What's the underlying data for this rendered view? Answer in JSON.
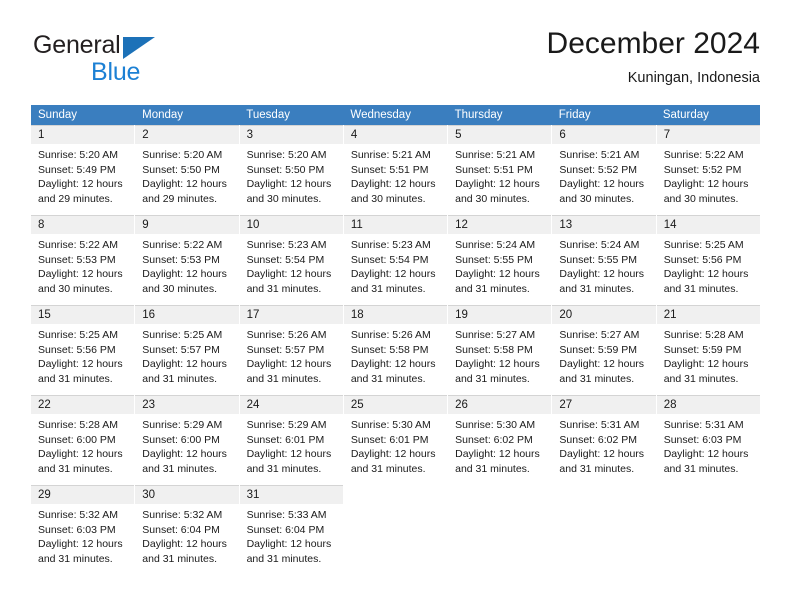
{
  "branding": {
    "logo_primary": "General",
    "logo_secondary": "Blue",
    "logo_icon": "blue-triangle"
  },
  "header": {
    "title": "December 2024",
    "subtitle": "Kuningan, Indonesia"
  },
  "colors": {
    "header_blue": "#3a7ebf",
    "daynum_band": "#f0f0f0",
    "logo_blue": "#1c80d4",
    "text": "#1a1a1a"
  },
  "weekdays": [
    "Sunday",
    "Monday",
    "Tuesday",
    "Wednesday",
    "Thursday",
    "Friday",
    "Saturday"
  ],
  "weeks": [
    [
      {
        "day": "1",
        "sunrise": "Sunrise: 5:20 AM",
        "sunset": "Sunset: 5:49 PM",
        "daylight1": "Daylight: 12 hours",
        "daylight2": "and 29 minutes."
      },
      {
        "day": "2",
        "sunrise": "Sunrise: 5:20 AM",
        "sunset": "Sunset: 5:50 PM",
        "daylight1": "Daylight: 12 hours",
        "daylight2": "and 29 minutes."
      },
      {
        "day": "3",
        "sunrise": "Sunrise: 5:20 AM",
        "sunset": "Sunset: 5:50 PM",
        "daylight1": "Daylight: 12 hours",
        "daylight2": "and 30 minutes."
      },
      {
        "day": "4",
        "sunrise": "Sunrise: 5:21 AM",
        "sunset": "Sunset: 5:51 PM",
        "daylight1": "Daylight: 12 hours",
        "daylight2": "and 30 minutes."
      },
      {
        "day": "5",
        "sunrise": "Sunrise: 5:21 AM",
        "sunset": "Sunset: 5:51 PM",
        "daylight1": "Daylight: 12 hours",
        "daylight2": "and 30 minutes."
      },
      {
        "day": "6",
        "sunrise": "Sunrise: 5:21 AM",
        "sunset": "Sunset: 5:52 PM",
        "daylight1": "Daylight: 12 hours",
        "daylight2": "and 30 minutes."
      },
      {
        "day": "7",
        "sunrise": "Sunrise: 5:22 AM",
        "sunset": "Sunset: 5:52 PM",
        "daylight1": "Daylight: 12 hours",
        "daylight2": "and 30 minutes."
      }
    ],
    [
      {
        "day": "8",
        "sunrise": "Sunrise: 5:22 AM",
        "sunset": "Sunset: 5:53 PM",
        "daylight1": "Daylight: 12 hours",
        "daylight2": "and 30 minutes."
      },
      {
        "day": "9",
        "sunrise": "Sunrise: 5:22 AM",
        "sunset": "Sunset: 5:53 PM",
        "daylight1": "Daylight: 12 hours",
        "daylight2": "and 30 minutes."
      },
      {
        "day": "10",
        "sunrise": "Sunrise: 5:23 AM",
        "sunset": "Sunset: 5:54 PM",
        "daylight1": "Daylight: 12 hours",
        "daylight2": "and 31 minutes."
      },
      {
        "day": "11",
        "sunrise": "Sunrise: 5:23 AM",
        "sunset": "Sunset: 5:54 PM",
        "daylight1": "Daylight: 12 hours",
        "daylight2": "and 31 minutes."
      },
      {
        "day": "12",
        "sunrise": "Sunrise: 5:24 AM",
        "sunset": "Sunset: 5:55 PM",
        "daylight1": "Daylight: 12 hours",
        "daylight2": "and 31 minutes."
      },
      {
        "day": "13",
        "sunrise": "Sunrise: 5:24 AM",
        "sunset": "Sunset: 5:55 PM",
        "daylight1": "Daylight: 12 hours",
        "daylight2": "and 31 minutes."
      },
      {
        "day": "14",
        "sunrise": "Sunrise: 5:25 AM",
        "sunset": "Sunset: 5:56 PM",
        "daylight1": "Daylight: 12 hours",
        "daylight2": "and 31 minutes."
      }
    ],
    [
      {
        "day": "15",
        "sunrise": "Sunrise: 5:25 AM",
        "sunset": "Sunset: 5:56 PM",
        "daylight1": "Daylight: 12 hours",
        "daylight2": "and 31 minutes."
      },
      {
        "day": "16",
        "sunrise": "Sunrise: 5:25 AM",
        "sunset": "Sunset: 5:57 PM",
        "daylight1": "Daylight: 12 hours",
        "daylight2": "and 31 minutes."
      },
      {
        "day": "17",
        "sunrise": "Sunrise: 5:26 AM",
        "sunset": "Sunset: 5:57 PM",
        "daylight1": "Daylight: 12 hours",
        "daylight2": "and 31 minutes."
      },
      {
        "day": "18",
        "sunrise": "Sunrise: 5:26 AM",
        "sunset": "Sunset: 5:58 PM",
        "daylight1": "Daylight: 12 hours",
        "daylight2": "and 31 minutes."
      },
      {
        "day": "19",
        "sunrise": "Sunrise: 5:27 AM",
        "sunset": "Sunset: 5:58 PM",
        "daylight1": "Daylight: 12 hours",
        "daylight2": "and 31 minutes."
      },
      {
        "day": "20",
        "sunrise": "Sunrise: 5:27 AM",
        "sunset": "Sunset: 5:59 PM",
        "daylight1": "Daylight: 12 hours",
        "daylight2": "and 31 minutes."
      },
      {
        "day": "21",
        "sunrise": "Sunrise: 5:28 AM",
        "sunset": "Sunset: 5:59 PM",
        "daylight1": "Daylight: 12 hours",
        "daylight2": "and 31 minutes."
      }
    ],
    [
      {
        "day": "22",
        "sunrise": "Sunrise: 5:28 AM",
        "sunset": "Sunset: 6:00 PM",
        "daylight1": "Daylight: 12 hours",
        "daylight2": "and 31 minutes."
      },
      {
        "day": "23",
        "sunrise": "Sunrise: 5:29 AM",
        "sunset": "Sunset: 6:00 PM",
        "daylight1": "Daylight: 12 hours",
        "daylight2": "and 31 minutes."
      },
      {
        "day": "24",
        "sunrise": "Sunrise: 5:29 AM",
        "sunset": "Sunset: 6:01 PM",
        "daylight1": "Daylight: 12 hours",
        "daylight2": "and 31 minutes."
      },
      {
        "day": "25",
        "sunrise": "Sunrise: 5:30 AM",
        "sunset": "Sunset: 6:01 PM",
        "daylight1": "Daylight: 12 hours",
        "daylight2": "and 31 minutes."
      },
      {
        "day": "26",
        "sunrise": "Sunrise: 5:30 AM",
        "sunset": "Sunset: 6:02 PM",
        "daylight1": "Daylight: 12 hours",
        "daylight2": "and 31 minutes."
      },
      {
        "day": "27",
        "sunrise": "Sunrise: 5:31 AM",
        "sunset": "Sunset: 6:02 PM",
        "daylight1": "Daylight: 12 hours",
        "daylight2": "and 31 minutes."
      },
      {
        "day": "28",
        "sunrise": "Sunrise: 5:31 AM",
        "sunset": "Sunset: 6:03 PM",
        "daylight1": "Daylight: 12 hours",
        "daylight2": "and 31 minutes."
      }
    ],
    [
      {
        "day": "29",
        "sunrise": "Sunrise: 5:32 AM",
        "sunset": "Sunset: 6:03 PM",
        "daylight1": "Daylight: 12 hours",
        "daylight2": "and 31 minutes."
      },
      {
        "day": "30",
        "sunrise": "Sunrise: 5:32 AM",
        "sunset": "Sunset: 6:04 PM",
        "daylight1": "Daylight: 12 hours",
        "daylight2": "and 31 minutes."
      },
      {
        "day": "31",
        "sunrise": "Sunrise: 5:33 AM",
        "sunset": "Sunset: 6:04 PM",
        "daylight1": "Daylight: 12 hours",
        "daylight2": "and 31 minutes."
      },
      {
        "day": "",
        "sunrise": "",
        "sunset": "",
        "daylight1": "",
        "daylight2": ""
      },
      {
        "day": "",
        "sunrise": "",
        "sunset": "",
        "daylight1": "",
        "daylight2": ""
      },
      {
        "day": "",
        "sunrise": "",
        "sunset": "",
        "daylight1": "",
        "daylight2": ""
      },
      {
        "day": "",
        "sunrise": "",
        "sunset": "",
        "daylight1": "",
        "daylight2": ""
      }
    ]
  ]
}
